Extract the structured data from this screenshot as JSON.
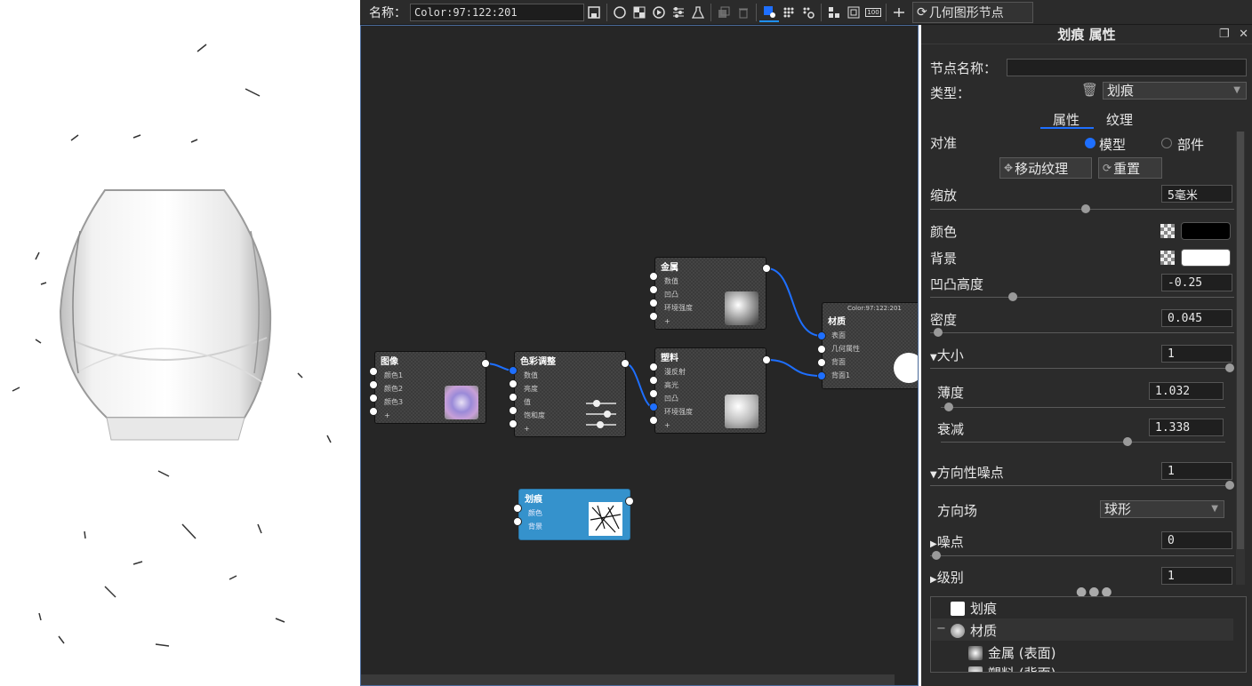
{
  "toolbar": {
    "name_label": "名称：",
    "name_value": "Color:97:122:201",
    "geometry_button": "几何图形节点",
    "icons": [
      "save-icon",
      "sphere-icon",
      "checker-icon",
      "play-icon",
      "sliders-icon",
      "erlenmeyer-icon",
      "copy-icon",
      "trash-icon",
      "node-add-icon",
      "grid-dots-icon",
      "grid-gear-icon",
      "layout-icon",
      "fit-icon",
      "zoom-100-icon",
      "pin-icon"
    ],
    "zoom_label": "100"
  },
  "graph": {
    "nodes": {
      "metal": {
        "title": "金属",
        "rows": [
          "数值",
          "凹凸",
          "环境强度",
          "+"
        ]
      },
      "material": {
        "title": "材质",
        "header": "Color:97:122:201",
        "rows": [
          "表面",
          "几何属性",
          "背面",
          "背面1"
        ]
      },
      "image": {
        "title": "图像",
        "rows": [
          "颜色1",
          "颜色2",
          "颜色3",
          "+"
        ]
      },
      "color_adjust": {
        "title": "色彩调整",
        "rows": [
          "数值",
          "亮度",
          "值",
          "饱和度",
          "+"
        ]
      },
      "plastic": {
        "title": "塑料",
        "rows": [
          "漫反射",
          "高光",
          "凹凸",
          "环境强度",
          "+"
        ]
      },
      "scratch": {
        "title": "划痕",
        "rows": [
          "颜色",
          "背景"
        ]
      }
    }
  },
  "props": {
    "title": "划痕 属性",
    "node_name_label": "节点名称：",
    "node_name_value": "",
    "type_label": "类型：",
    "type_value": "划痕",
    "tabs": [
      "属性",
      "纹理"
    ],
    "align_label": "对准",
    "align_options": [
      "模型",
      "部件"
    ],
    "move_texture_btn": "移动纹理",
    "reset_btn": "重置",
    "scale_label": "缩放",
    "scale_value": "5毫米",
    "color_label": "颜色",
    "color_value": "#000000",
    "bg_label": "背景",
    "bg_value": "#ffffff",
    "bump_label": "凹凸高度",
    "bump_value": "-0.25",
    "density_label": "密度",
    "density_value": "0.045",
    "size_label": "大小",
    "size_value": "1",
    "thin_label": "薄度",
    "thin_value": "1.032",
    "decay_label": "衰减",
    "decay_value": "1.338",
    "dir_noise_label": "方向性噪点",
    "dir_noise_value": "1",
    "dir_field_label": "方向场",
    "dir_field_value": "球形",
    "noise_label": "噪点",
    "noise_value": "0",
    "level_label": "级别",
    "level_value": "1",
    "tree": [
      "划痕",
      "材质",
      "金属 (表面)",
      "塑料 (背面)"
    ],
    "tree_collapse": "−"
  },
  "colors": {
    "accent": "#1e6fff",
    "scratch_node": "#3592cc",
    "panel": "#2b2b2b",
    "graph": "#262626"
  }
}
